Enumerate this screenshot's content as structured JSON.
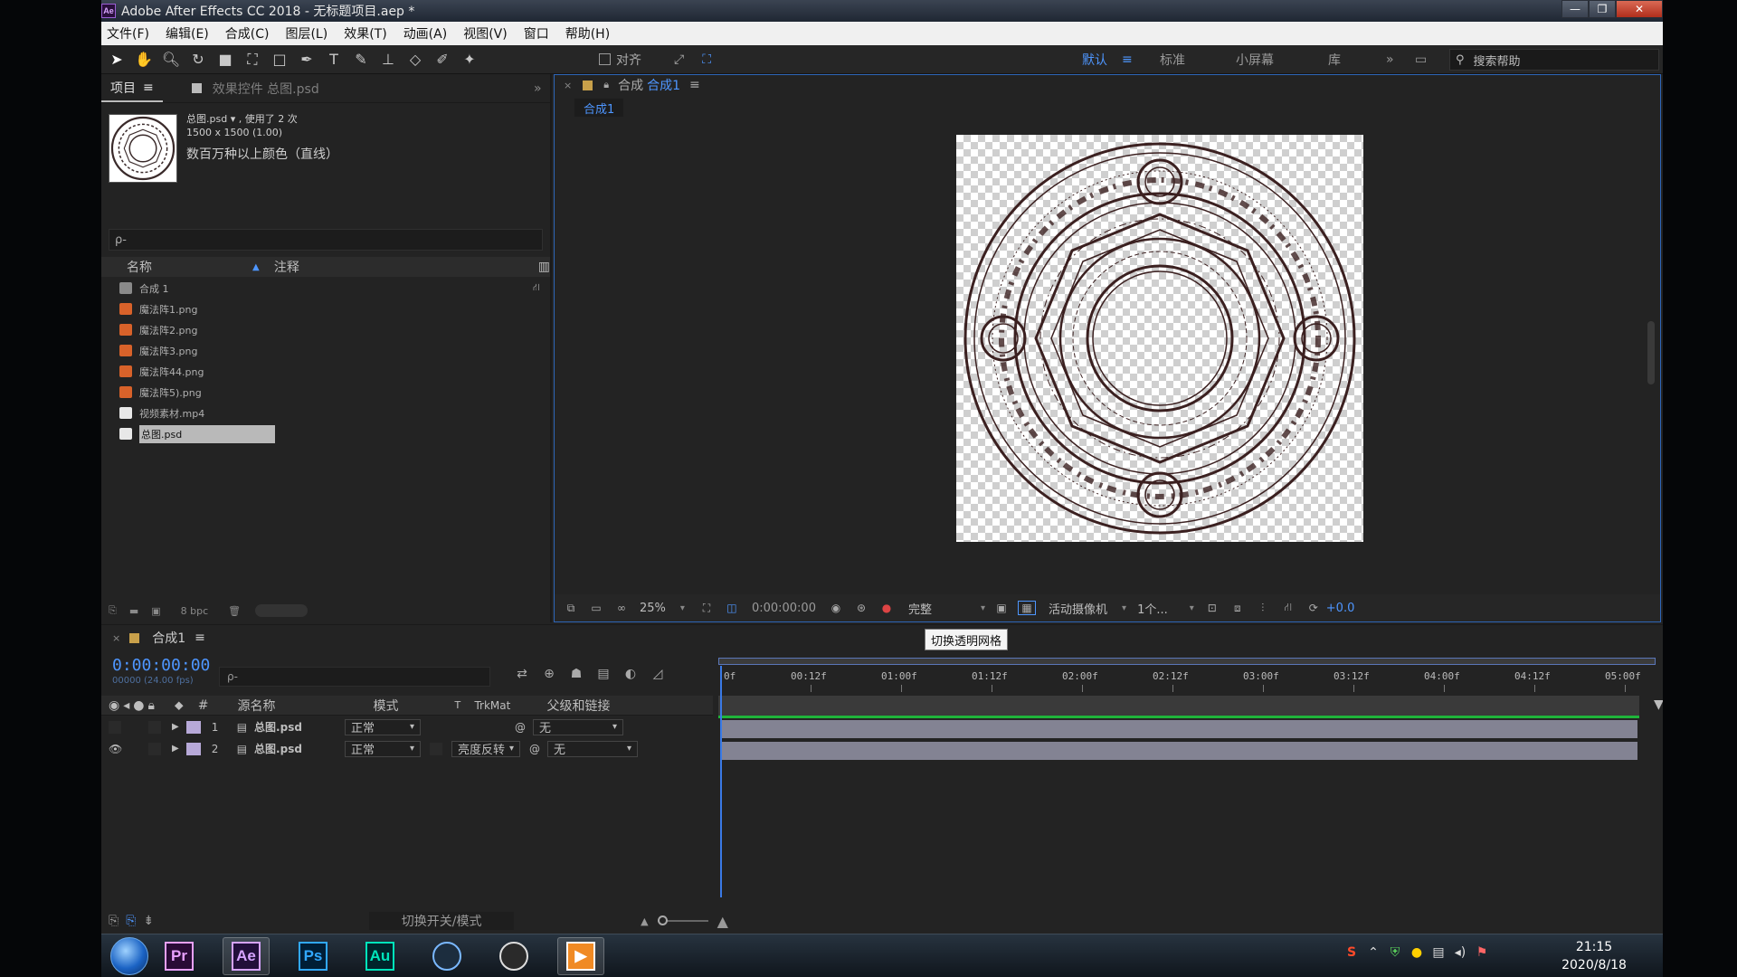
{
  "window": {
    "title": "Adobe After Effects CC 2018 - 无标题项目.aep *",
    "app_badge": "Ae",
    "controls": [
      "—",
      "❐",
      "✕"
    ]
  },
  "menu": [
    "文件(F)",
    "编辑(E)",
    "合成(C)",
    "图层(L)",
    "效果(T)",
    "动画(A)",
    "视图(V)",
    "窗口",
    "帮助(H)"
  ],
  "toolbar": {
    "align_label": "对齐",
    "workspaces": [
      "默认",
      "标准",
      "小屏幕",
      "库"
    ],
    "more": "»",
    "search_placeholder": "搜索帮助"
  },
  "project": {
    "tab_label": "项目",
    "effects_tab": "效果控件 总图.psd",
    "selected_name": "总图.psd ▾ , 使用了 2 次",
    "selected_dims": "1500 x 1500 (1.00)",
    "selected_color": "数百万种以上颜色（直线）",
    "search_placeholder": "ρ-",
    "col_name": "名称",
    "col_comment": "注释",
    "items": [
      {
        "name": "合成 1",
        "type": "comp"
      },
      {
        "name": "魔法阵1.png",
        "type": "image"
      },
      {
        "name": "魔法阵2.png",
        "type": "image"
      },
      {
        "name": "魔法阵3.png",
        "type": "image"
      },
      {
        "name": "魔法阵44.png",
        "type": "image"
      },
      {
        "name": "魔法阵5).png",
        "type": "image"
      },
      {
        "name": "视频素材.mp4",
        "type": "video"
      },
      {
        "name": "总图.psd",
        "type": "psd",
        "selected": true
      }
    ],
    "bpc": "8 bpc"
  },
  "composition": {
    "tab_label": "合成",
    "tab_name": "合成1",
    "sub_tab": "合成1",
    "zoom": "25%",
    "time": "0:00:00:00",
    "resolution": "完整",
    "camera": "活动摄像机",
    "views": "1个...",
    "exposure": "+0.0"
  },
  "tooltip": "切换透明网格",
  "timeline": {
    "tab_label": "合成1",
    "timecode": "0:00:00:00",
    "fps": "00000 (24.00 fps)",
    "search_placeholder": "ρ-",
    "headers": {
      "num": "#",
      "source": "源名称",
      "mode": "模式",
      "t": "T",
      "trkmat": "TrkMat",
      "parent": "父级和链接"
    },
    "layers": [
      {
        "num": "1",
        "name": "总图.psd",
        "mode": "正常",
        "trkmat": "",
        "parent": "无",
        "visible": false
      },
      {
        "num": "2",
        "name": "总图.psd",
        "mode": "正常",
        "trkmat": "亮度反转",
        "parent": "无",
        "visible": true
      }
    ],
    "ruler": [
      "0f",
      "00:12f",
      "01:00f",
      "01:12f",
      "02:00f",
      "02:12f",
      "03:00f",
      "03:12f",
      "04:00f",
      "04:12f",
      "05:00f"
    ],
    "footer_toggle": "切换开关/模式"
  },
  "taskbar": {
    "apps": [
      {
        "label": "Pr",
        "color": "#e8a0ff",
        "bg": "#2a0b36"
      },
      {
        "label": "Ae",
        "color": "#d6a3ff",
        "bg": "#220f3a",
        "active": true
      },
      {
        "label": "Ps",
        "color": "#31a8ff",
        "bg": "#001e36"
      },
      {
        "label": "Au",
        "color": "#00e4bb",
        "bg": "#00252b"
      },
      {
        "label": "",
        "color": "#7ab8ff",
        "bg": "#1c2d3e"
      },
      {
        "label": "",
        "color": "#ddd",
        "bg": "#2a2a2a"
      },
      {
        "label": "▶",
        "color": "#fff",
        "bg": "#f08a24",
        "active": true
      }
    ],
    "time": "21:15",
    "date": "2020/8/18"
  },
  "colors": {
    "accent": "#4e96ff",
    "panel": "#232323",
    "track_bar": "#838393",
    "green_line": "#1fb43a"
  }
}
